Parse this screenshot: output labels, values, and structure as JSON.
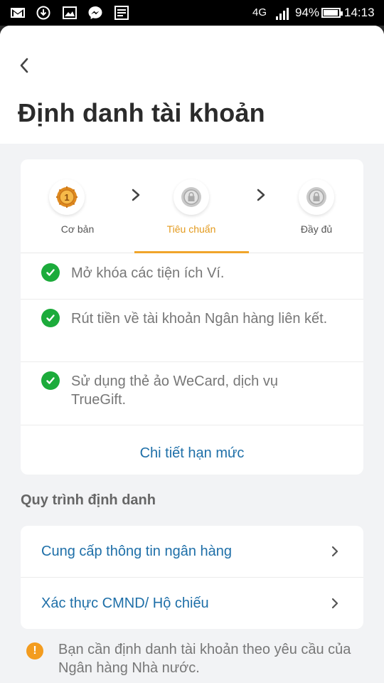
{
  "status_bar": {
    "network": "4G",
    "battery": "94%",
    "battery_level": 0.94,
    "time": "14:13",
    "notification_icons": [
      "gmail-icon",
      "download-icon",
      "gallery-icon",
      "messenger-icon",
      "news-icon"
    ]
  },
  "header": {
    "back_icon": "chevron-left-icon",
    "title": "Định danh tài khoản"
  },
  "levels": {
    "steps": [
      {
        "label": "Cơ bản",
        "icon": "gold-medal-icon",
        "active": false
      },
      {
        "label": "Tiêu chuẩn",
        "icon": "locked-medal-icon",
        "active": true
      },
      {
        "label": "Đầy đủ",
        "icon": "locked-medal-icon",
        "active": false
      }
    ],
    "benefits": [
      "Mở khóa các tiện ích Ví.",
      "Rút tiền về tài khoản Ngân hàng liên kết.",
      "Sử dụng thẻ ảo WeCard, dịch vụ TrueGift."
    ],
    "limit_link": "Chi tiết hạn mức"
  },
  "process": {
    "title": "Quy trình định danh",
    "items": [
      "Cung cấp thông tin ngân hàng",
      "Xác thực CMND/ Hộ chiếu"
    ]
  },
  "notice": {
    "icon": "!",
    "text": "Bạn cần định danh tài khoản theo yêu cầu của Ngân hàng Nhà nước."
  },
  "colors": {
    "accent": "#f0a52b",
    "link": "#1e6fa8",
    "check": "#1cab3b",
    "warning": "#f39c1f"
  }
}
